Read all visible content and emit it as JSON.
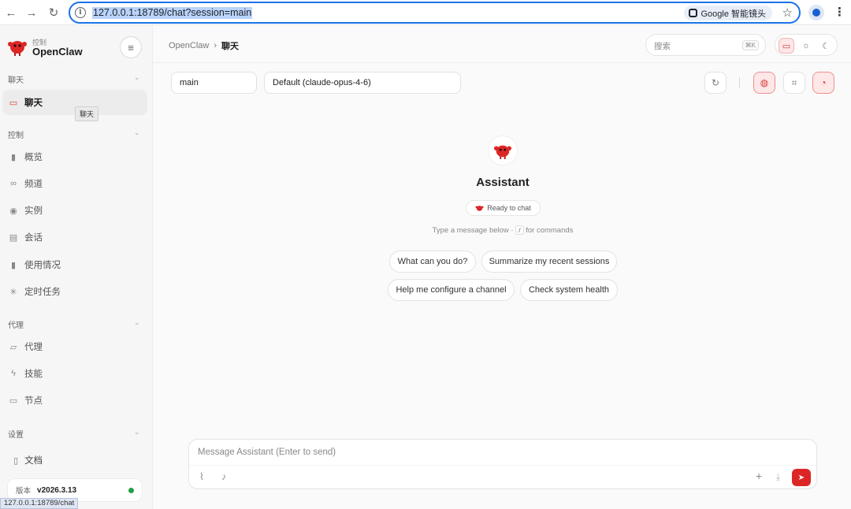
{
  "browser": {
    "url": "127.0.0.1:18789/chat?session=main",
    "lens_label": "Google 智能镜头",
    "status_url": "127.0.0.1:18789/chat"
  },
  "sidebar": {
    "brand_small": "控制",
    "brand_name": "OpenClaw",
    "sections": [
      {
        "title": "聊天",
        "items": [
          {
            "label": "聊天",
            "icon": "chat-icon",
            "active": true
          }
        ]
      },
      {
        "title": "控制",
        "items": [
          {
            "label": "概览",
            "icon": "bar-chart-icon"
          },
          {
            "label": "频道",
            "icon": "link-icon"
          },
          {
            "label": "实例",
            "icon": "broadcast-icon"
          },
          {
            "label": "会话",
            "icon": "document-icon"
          },
          {
            "label": "使用情况",
            "icon": "bar-chart-icon"
          },
          {
            "label": "定时任务",
            "icon": "spinner-icon"
          }
        ]
      },
      {
        "title": "代理",
        "items": [
          {
            "label": "代理",
            "icon": "folder-icon"
          },
          {
            "label": "技能",
            "icon": "lightning-icon"
          },
          {
            "label": "节点",
            "icon": "monitor-icon"
          }
        ]
      },
      {
        "title": "设置",
        "items": []
      }
    ],
    "tooltip": "聊天",
    "docs_label": "文档",
    "version_label": "版本",
    "version_value": "v2026.3.13"
  },
  "header": {
    "breadcrumb_root": "OpenClaw",
    "breadcrumb_sep": "›",
    "breadcrumb_current": "聊天",
    "search_placeholder": "搜索",
    "search_shortcut": "⌘K"
  },
  "session": {
    "session_name": "main",
    "model": "Default (claude-opus-4-6)"
  },
  "hero": {
    "name": "Assistant",
    "status": "Ready to chat",
    "hint_before": "Type a message below · ",
    "hint_key": "/",
    "hint_after": " for commands"
  },
  "suggestions": [
    "What can you do?",
    "Summarize my recent sessions",
    "Help me configure a channel",
    "Check system health"
  ],
  "composer": {
    "placeholder": "Message Assistant (Enter to send)"
  },
  "colors": {
    "accent": "#dc2626",
    "status_online": "#22a046",
    "browser_focus": "#1a73e8"
  }
}
